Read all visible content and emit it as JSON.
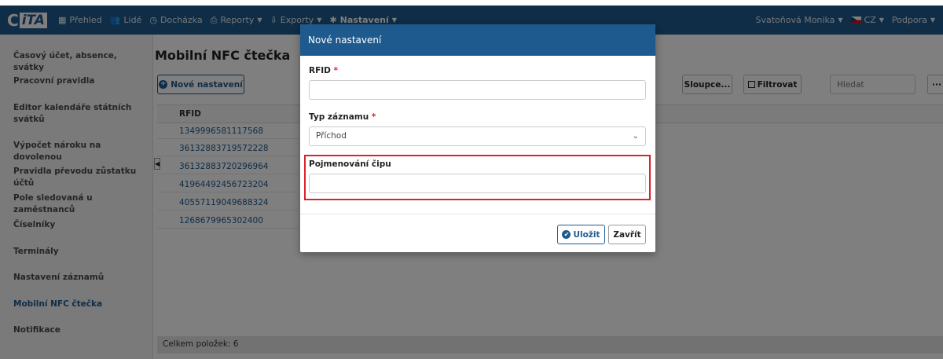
{
  "nav": {
    "logo": "CiTA",
    "items": [
      {
        "label": "Přehled",
        "icon": "grid-icon"
      },
      {
        "label": "Lidé",
        "icon": "people-icon"
      },
      {
        "label": "Docházka",
        "icon": "clock-icon"
      },
      {
        "label": "Reporty",
        "icon": "print-icon"
      },
      {
        "label": "Exporty",
        "icon": "export-icon"
      },
      {
        "label": "Nastavení",
        "icon": "gear-icon"
      }
    ],
    "user": "Svatoňová Monika",
    "language": "CZ",
    "support": "Podpora"
  },
  "sidebar": {
    "items": [
      {
        "label": "Časový účet, absence, svátky"
      },
      {
        "label": "Pracovní pravidla"
      },
      {
        "label": "Editor kalendáře státních svátků"
      },
      {
        "label": "Výpočet nároku na dovolenou"
      },
      {
        "label": "Pravidla převodu zůstatku účtů"
      },
      {
        "label": "Pole sledovaná u zaměstnanců"
      },
      {
        "label": "Číselníky"
      },
      {
        "label": "Terminály"
      },
      {
        "label": "Nastavení záznamů"
      },
      {
        "label": "Mobilní NFC čtečka"
      },
      {
        "label": "Notifikace"
      }
    ]
  },
  "main": {
    "title": "Mobilní NFC čtečka",
    "new_button": "Nové nastavení",
    "columns_button": "Sloupce...",
    "filter_button": "Filtrovat",
    "search_placeholder": "Hledat",
    "more_button": "···",
    "column_header": "RFID",
    "rows": [
      "1349996581117568",
      "36132883719572228",
      "36132883720296964",
      "41964492456723204",
      "40557119049688324",
      "1268679965302400"
    ],
    "footer": "Celkem položek: 6"
  },
  "modal": {
    "title": "Nové nastavení",
    "rfid_label": "RFID",
    "type_label": "Typ záznamu",
    "type_value": "Příchod",
    "chip_label": "Pojmenování čipu",
    "save_label": "Uložit",
    "close_label": "Zavřít"
  },
  "colors": {
    "primary": "#1e5a8e",
    "required": "#d9242b",
    "highlight": "#d9242b"
  }
}
